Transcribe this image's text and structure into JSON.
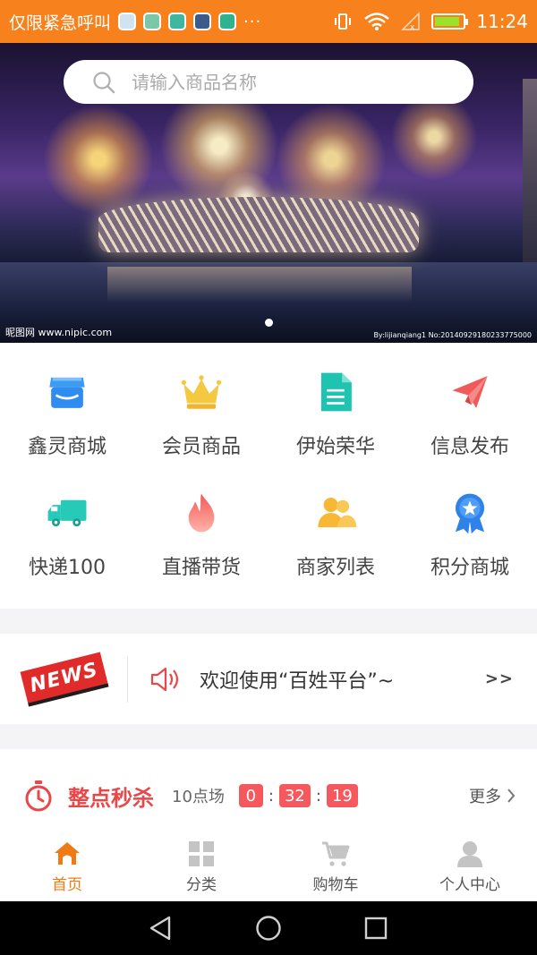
{
  "status_bar": {
    "carrier": "仅限紧急呼叫",
    "more": "···",
    "time": "11:24",
    "battery_level": 0.9
  },
  "search": {
    "placeholder": "请输入商品名称"
  },
  "banner": {
    "watermark_left": "昵图网 www.nipic.com",
    "watermark_right": "By:lijianqiang1 No:20140929180233775000",
    "slide_count": 1,
    "active_slide": 1
  },
  "categories": [
    {
      "label": "鑫灵商城",
      "icon": "store-icon",
      "color": "#2f8cf0"
    },
    {
      "label": "会员商品",
      "icon": "crown-icon",
      "color": "#f5c842"
    },
    {
      "label": "伊始荣华",
      "icon": "document-icon",
      "color": "#1ec4b0"
    },
    {
      "label": "信息发布",
      "icon": "paper-plane-icon",
      "color": "#f05a5a"
    },
    {
      "label": "快递100",
      "icon": "truck-icon",
      "color": "#27c9b8"
    },
    {
      "label": "直播带货",
      "icon": "flame-icon",
      "color": "#f25a5a"
    },
    {
      "label": "商家列表",
      "icon": "people-icon",
      "color": "#f7b935"
    },
    {
      "label": "积分商城",
      "icon": "badge-icon",
      "color": "#2e82e8"
    }
  ],
  "news": {
    "badge": "NEWS",
    "text": "欢迎使用“百姓平台”~",
    "more": ">>"
  },
  "flash_sale": {
    "title": "整点秒杀",
    "session": "10点场",
    "hours": "0",
    "minutes": "32",
    "seconds": "19",
    "colon": ":",
    "more": "更多"
  },
  "tabs": [
    {
      "label": "首页",
      "icon": "home-icon",
      "active": true
    },
    {
      "label": "分类",
      "icon": "grid-icon",
      "active": false
    },
    {
      "label": "购物车",
      "icon": "cart-icon",
      "active": false
    },
    {
      "label": "个人中心",
      "icon": "person-icon",
      "active": false
    }
  ],
  "colors": {
    "accent": "#f6811d",
    "active_tab": "#f07a14",
    "flash_red": "#e8484a"
  }
}
